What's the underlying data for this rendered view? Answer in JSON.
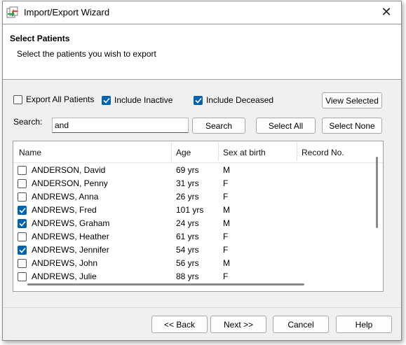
{
  "window": {
    "title": "Import/Export Wizard",
    "close_glyph": "✕"
  },
  "header": {
    "title": "Select Patients",
    "subtitle": "Select the patients you wish to export"
  },
  "options": {
    "export_all": {
      "label": "Export All Patients",
      "checked": false
    },
    "include_inactive": {
      "label": "Include Inactive",
      "checked": true
    },
    "include_deceased": {
      "label": "Include Deceased",
      "checked": true
    },
    "view_selected_label": "View Selected"
  },
  "search": {
    "label": "Search:",
    "value": "and",
    "search_button": "Search",
    "select_all_button": "Select All",
    "select_none_button": "Select None"
  },
  "table": {
    "columns": [
      "Name",
      "Age",
      "Sex at birth",
      "Record No."
    ],
    "rows": [
      {
        "checked": false,
        "name": "ANDERSON, David",
        "age": "69 yrs",
        "sex": "M",
        "record": ""
      },
      {
        "checked": false,
        "name": "ANDERSON, Penny",
        "age": "31 yrs",
        "sex": "F",
        "record": ""
      },
      {
        "checked": false,
        "name": "ANDREWS, Anna",
        "age": "26 yrs",
        "sex": "F",
        "record": ""
      },
      {
        "checked": true,
        "name": "ANDREWS, Fred",
        "age": "101 yrs",
        "sex": "M",
        "record": ""
      },
      {
        "checked": true,
        "name": "ANDREWS, Graham",
        "age": "24 yrs",
        "sex": "M",
        "record": ""
      },
      {
        "checked": false,
        "name": "ANDREWS, Heather",
        "age": "61 yrs",
        "sex": "F",
        "record": ""
      },
      {
        "checked": true,
        "name": "ANDREWS, Jennifer",
        "age": "54 yrs",
        "sex": "F",
        "record": ""
      },
      {
        "checked": false,
        "name": "ANDREWS, John",
        "age": "56 yrs",
        "sex": "M",
        "record": ""
      },
      {
        "checked": false,
        "name": "ANDREWS, Julie",
        "age": "88 yrs",
        "sex": "F",
        "record": ""
      }
    ]
  },
  "footer": {
    "back": "<< Back",
    "next": "Next >>",
    "cancel": "Cancel",
    "help": "Help"
  },
  "colors": {
    "accent": "#0063b1",
    "window_bg": "#f0f0f0"
  }
}
